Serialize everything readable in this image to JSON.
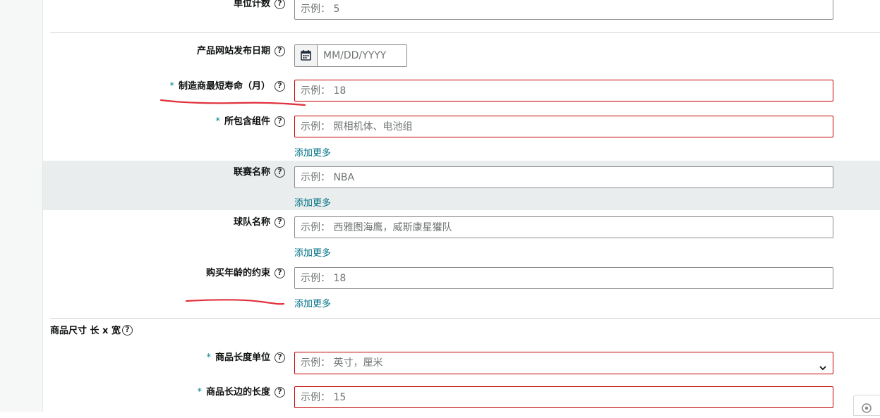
{
  "fields": {
    "unit_count": {
      "label": "单位计数",
      "placeholder": "示例： 5"
    },
    "launch_date": {
      "label": "产品网站发布日期",
      "placeholder": "MM/DD/YYYY"
    },
    "manufacturer_lifespan": {
      "required": "*",
      "label": "制造商最短寿命（月）",
      "placeholder": "示例： 18"
    },
    "included_components": {
      "required": "*",
      "label": "所包含组件",
      "placeholder": "示例： 照相机体、电池组",
      "add_more": "添加更多"
    },
    "league_name": {
      "label": "联赛名称",
      "placeholder": "示例： NBA",
      "add_more": "添加更多"
    },
    "team_name": {
      "label": "球队名称",
      "placeholder": "示例： 西雅图海鹰，威斯康星獾队",
      "add_more": "添加更多"
    },
    "purchase_age_limit": {
      "label": "购买年龄的约束",
      "placeholder": "示例： 18",
      "add_more": "添加更多"
    },
    "dimensions_section": {
      "label": "商品尺寸 长 x 宽"
    },
    "length_unit": {
      "required": "*",
      "label": "商品长度单位",
      "placeholder": "示例： 英寸，厘米"
    },
    "length_longest": {
      "required": "*",
      "label": "商品长边的长度",
      "placeholder": "示例： 15"
    }
  },
  "help_glyph": "?",
  "colors": {
    "required_mark": "#008296",
    "link": "#007185",
    "error_border": "#c40000",
    "highlight_row": "#eaeded",
    "annotation_stroke": "#e0323c"
  },
  "icons": [
    "calendar-icon",
    "help-icon",
    "chevron-down-icon"
  ]
}
